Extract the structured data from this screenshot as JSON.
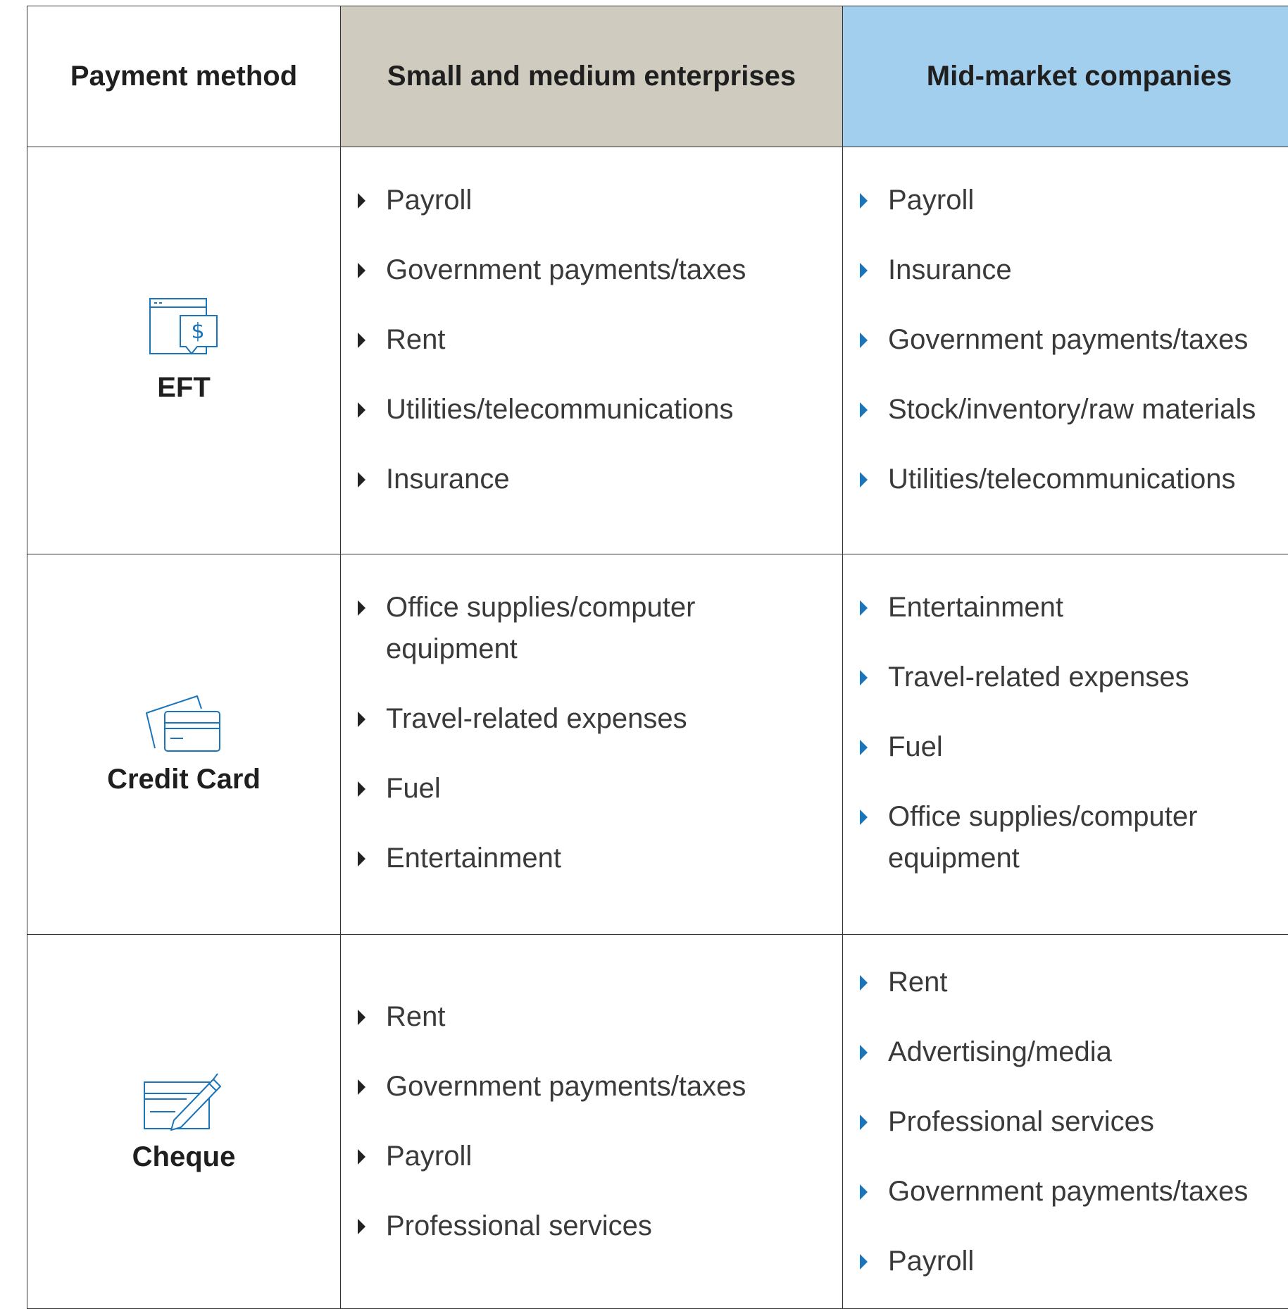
{
  "headers": {
    "payment_method": "Payment method",
    "sme": "Small and medium enterprises",
    "mid_market": "Mid-market companies"
  },
  "colors": {
    "sme_header_bg": "#cfcbbf",
    "mid_header_bg": "#a3cfee",
    "bullet_sme": "#222222",
    "bullet_mid": "#1a75bb",
    "icon_stroke": "#1a75bb"
  },
  "rows": [
    {
      "method": "EFT",
      "icon": "eft-invoice-icon",
      "sme": [
        "Payroll",
        "Government payments/taxes",
        "Rent",
        "Utilities/telecommunications",
        "Insurance"
      ],
      "mid": [
        "Payroll",
        "Insurance",
        "Government payments/taxes",
        "Stock/inventory/raw materials",
        "Utilities/telecommunications"
      ]
    },
    {
      "method": "Credit Card",
      "icon": "credit-card-icon",
      "sme": [
        "Office supplies/computer equipment",
        "Travel-related expenses",
        "Fuel",
        "Entertainment"
      ],
      "mid": [
        "Entertainment",
        "Travel-related expenses",
        "Fuel",
        "Office supplies/computer equipment"
      ]
    },
    {
      "method": "Cheque",
      "icon": "cheque-pen-icon",
      "sme": [
        "Rent",
        "Government payments/taxes",
        "Payroll",
        "Professional services"
      ],
      "mid": [
        "Rent",
        "Advertising/media",
        "Professional services",
        "Government payments/taxes",
        "Payroll"
      ]
    }
  ]
}
